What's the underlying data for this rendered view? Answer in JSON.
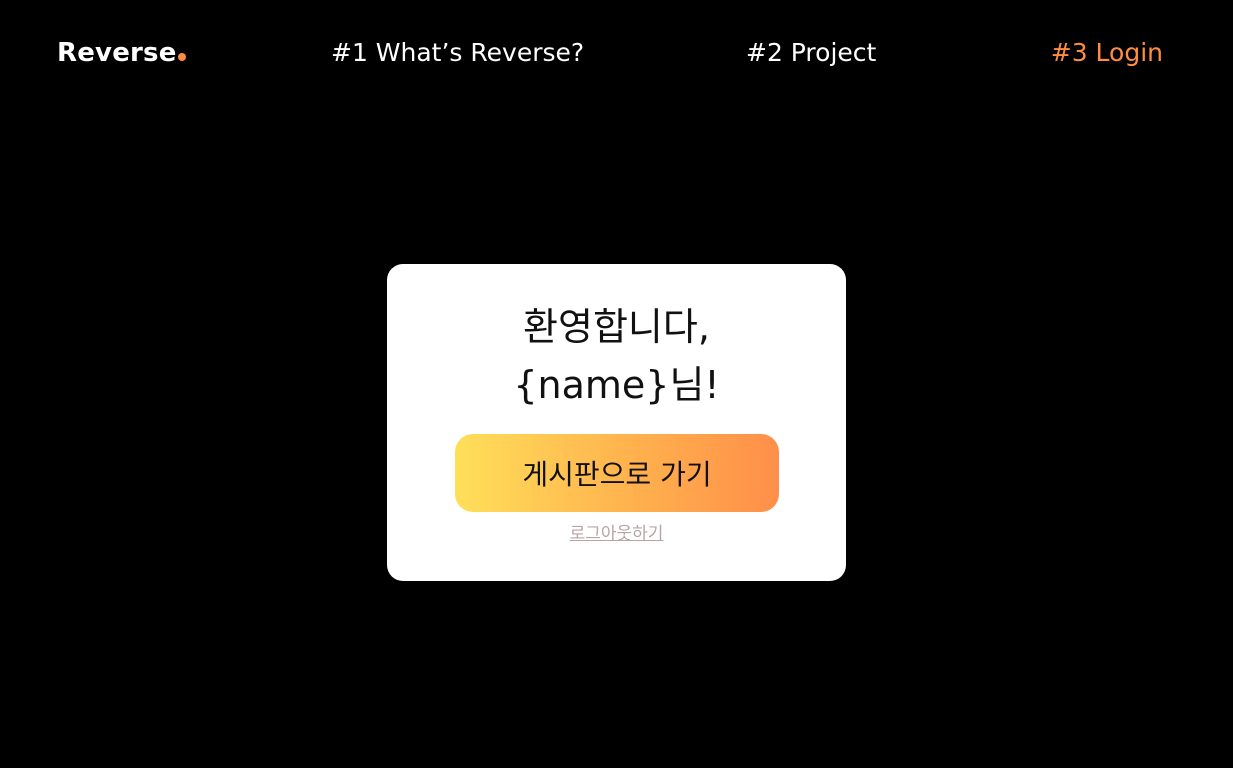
{
  "header": {
    "logo_text": "Reverse",
    "nav": [
      {
        "label": "#1 What’s Reverse?",
        "active": false
      },
      {
        "label": "#2 Project",
        "active": false
      },
      {
        "label": "#3 Login",
        "active": true
      }
    ]
  },
  "card": {
    "welcome_line1": "환영합니다,",
    "welcome_line2": "{name}님!",
    "board_button_label": "게시판으로 가기",
    "logout_label": "로그아웃하기"
  },
  "colors": {
    "background": "#000000",
    "accent": "#ff8c42",
    "card": "#ffffff",
    "button_gradient_start": "#ffdf5a",
    "button_gradient_end": "#ff8f4a",
    "logout_text": "#b8a4a4"
  }
}
